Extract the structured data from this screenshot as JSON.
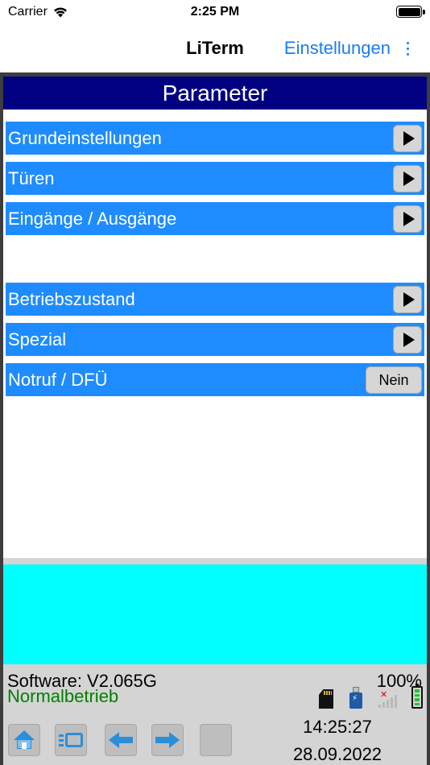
{
  "status_bar": {
    "carrier": "Carrier",
    "time": "2:25 PM"
  },
  "nav_bar": {
    "title": "LiTerm",
    "settings_label": "Einstellungen"
  },
  "screen": {
    "title": "Parameter",
    "menu": [
      {
        "label": "Grundeinstellungen"
      },
      {
        "label": "Türen"
      },
      {
        "label": "Eingänge / Ausgänge"
      },
      {
        "label": "Betriebszustand"
      },
      {
        "label": "Spezial"
      },
      {
        "label": "Notruf / DFÜ",
        "value": "Nein"
      }
    ]
  },
  "info": {
    "software": "Software: V2.065G",
    "mode": "Normalbetrieb",
    "percent": "100%"
  },
  "toolbar": {
    "time": "14:25:27",
    "date": "28.09.2022"
  },
  "colors": {
    "title_bar": "#000080",
    "menu_row": "#1e8cff",
    "cyan_panel": "#00ffff",
    "ios_accent": "#1a7cf5",
    "mode_text": "#008000"
  }
}
